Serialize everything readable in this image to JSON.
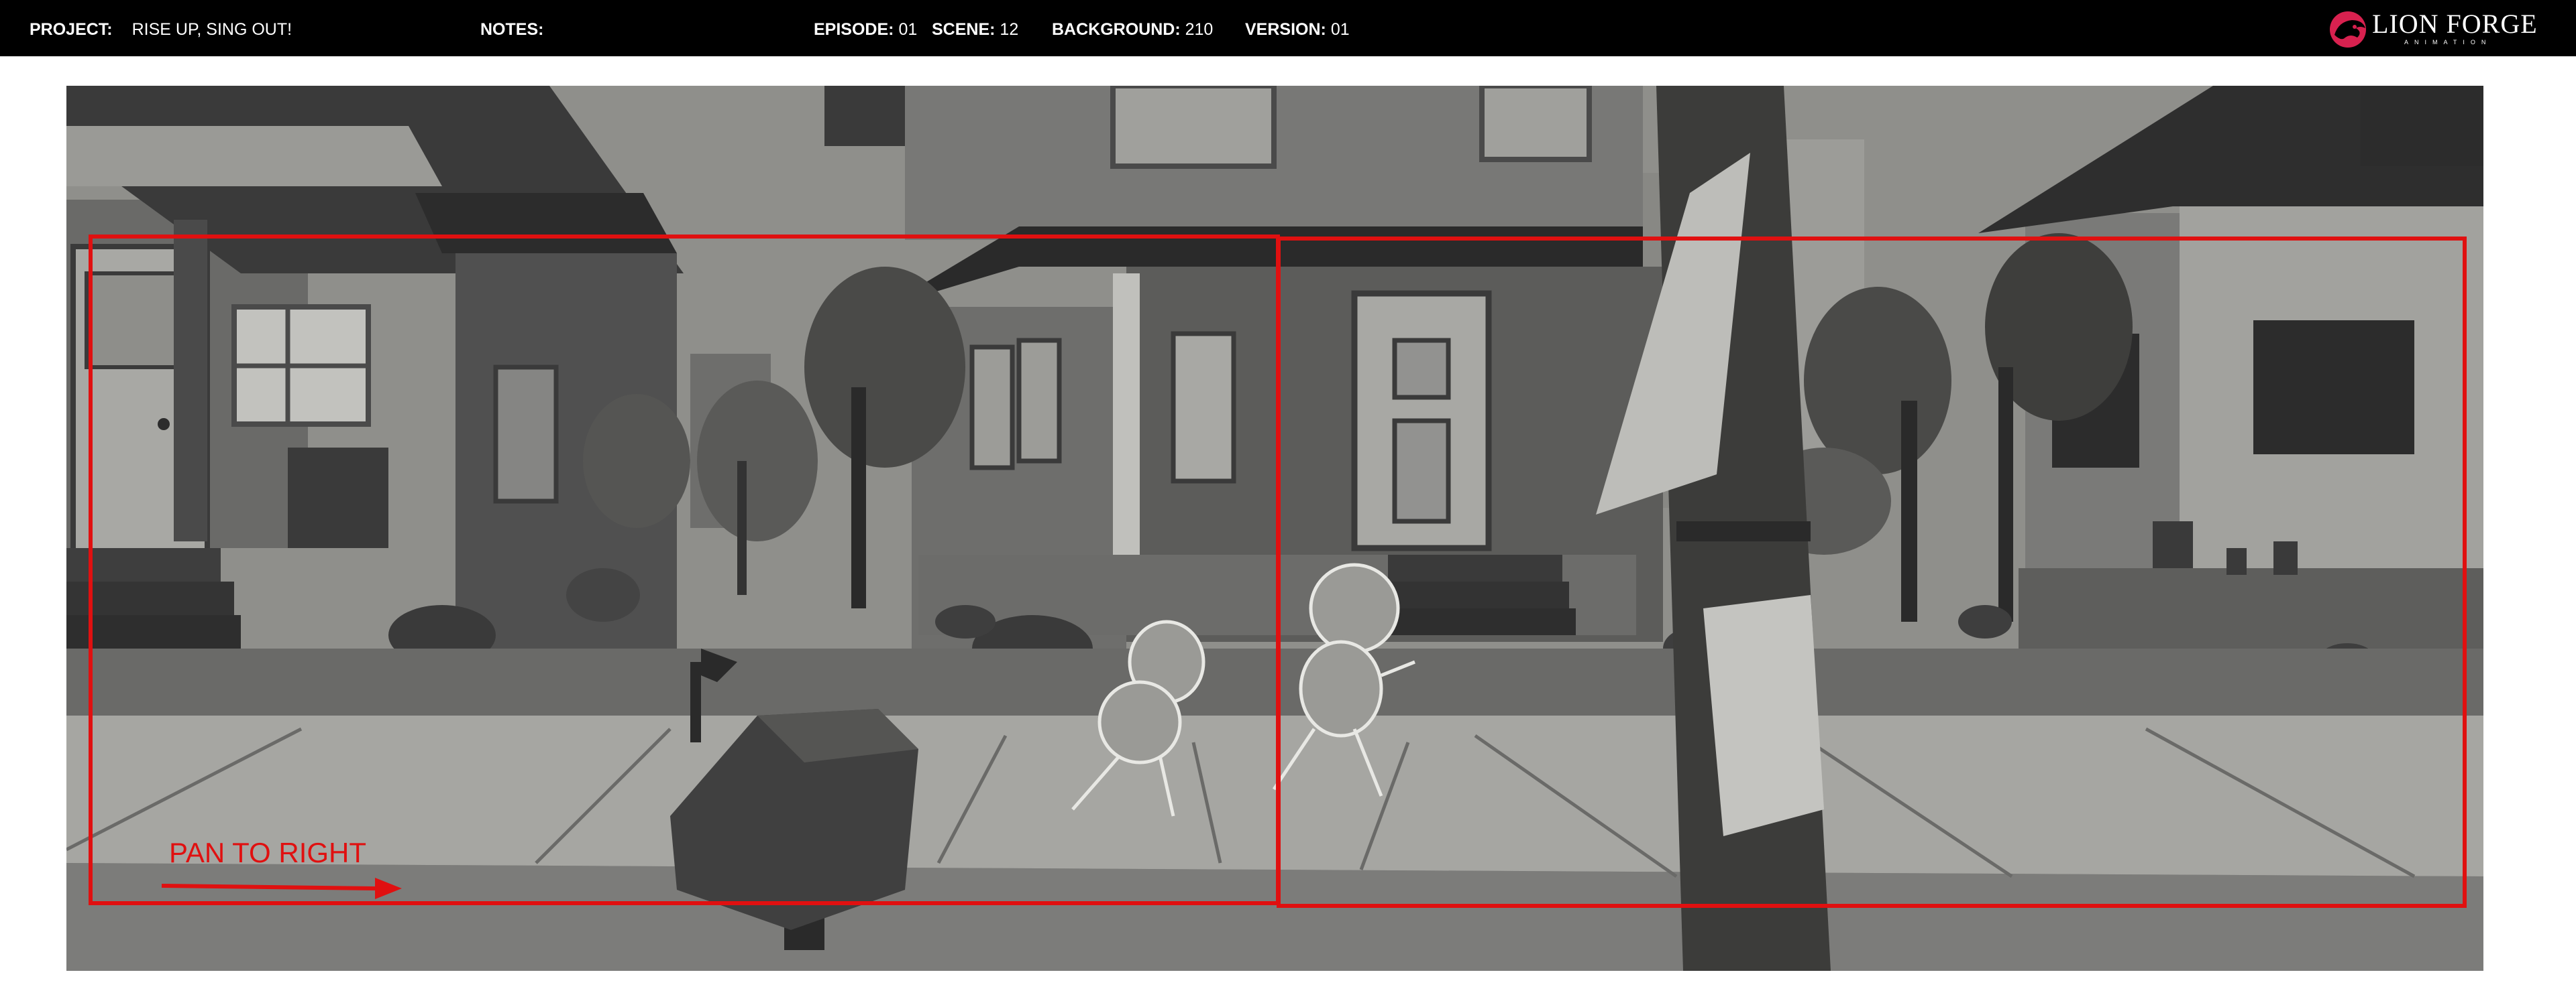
{
  "header": {
    "project_label": "PROJECT:",
    "project_value": "RISE UP, SING OUT!",
    "notes_label": "NOTES:",
    "notes_value": "",
    "episode_label": "EPISODE:",
    "episode_value": "01",
    "scene_label": "SCENE:",
    "scene_value": "12",
    "background_label": "BACKGROUND:",
    "background_value": "210",
    "version_label": "VERSION:",
    "version_value": "01"
  },
  "logo": {
    "name": "LION FORGE",
    "sub": "ANIMATION",
    "accent_color": "#d8214f"
  },
  "annotation": {
    "pan_text": "PAN TO RIGHT",
    "frame_color": "#e01010"
  }
}
